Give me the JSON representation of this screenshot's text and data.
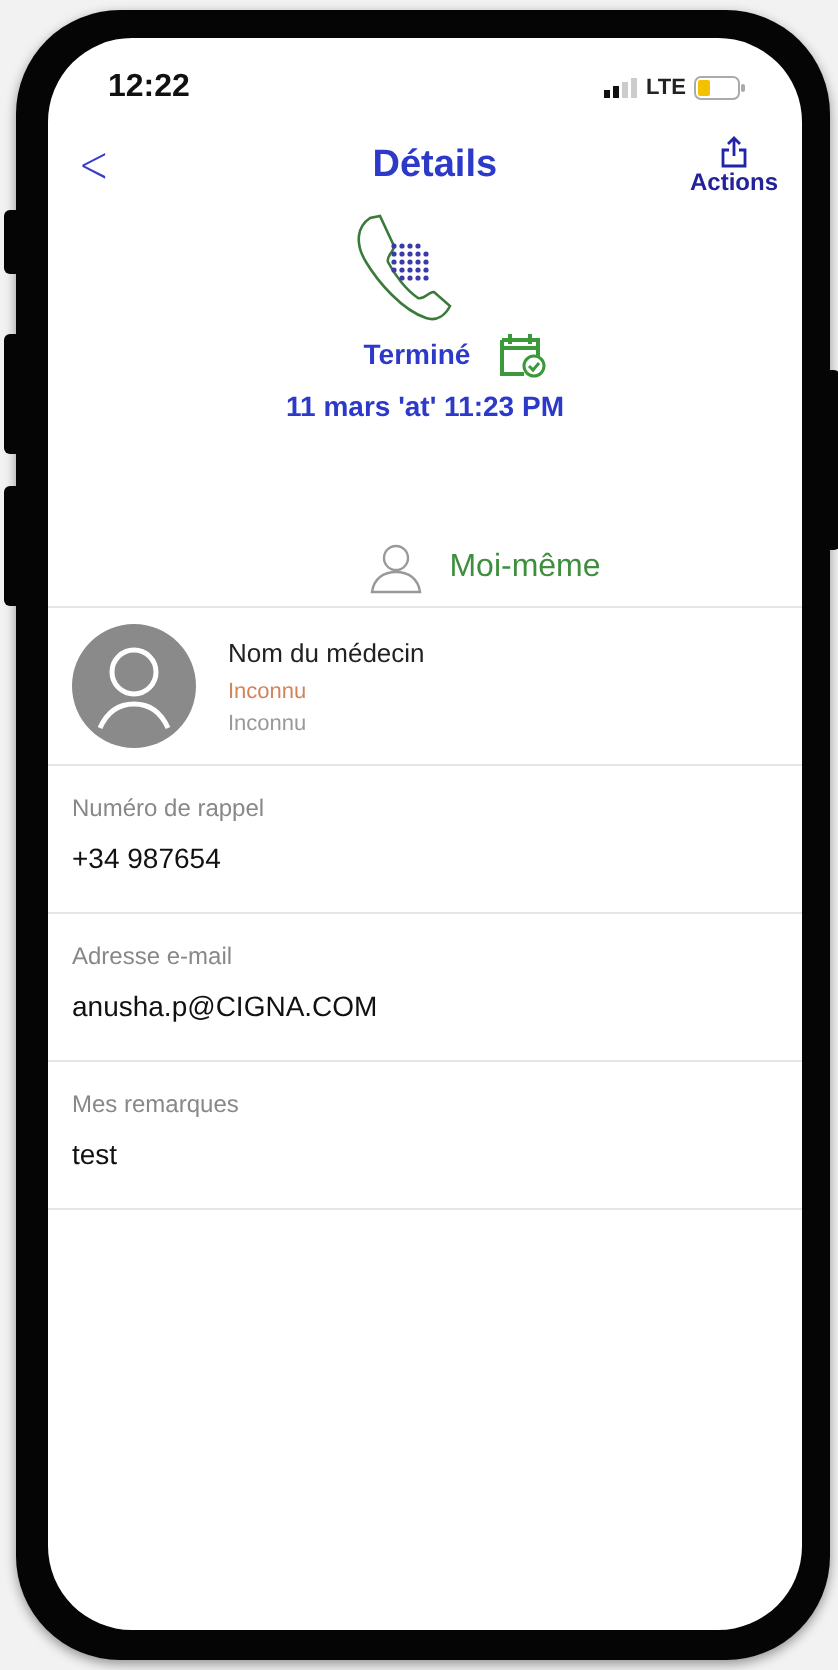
{
  "status_bar": {
    "time": "12:22",
    "network": "LTE"
  },
  "nav": {
    "back": "<",
    "title": "Détails",
    "action": "Actions"
  },
  "call": {
    "status": "Terminé",
    "datetime": "11 mars 'at' 11:23 PM"
  },
  "patient": {
    "name": "Moi-même"
  },
  "doctor": {
    "label": "Nom du médecin",
    "status": "Inconnu",
    "detail": "Inconnu"
  },
  "fields": [
    {
      "label": "Numéro de rappel",
      "value": "+34 987654"
    },
    {
      "label": "Adresse e-mail",
      "value": "anusha.p@CIGNA.COM"
    },
    {
      "label": "Mes remarques",
      "value": "test"
    }
  ]
}
